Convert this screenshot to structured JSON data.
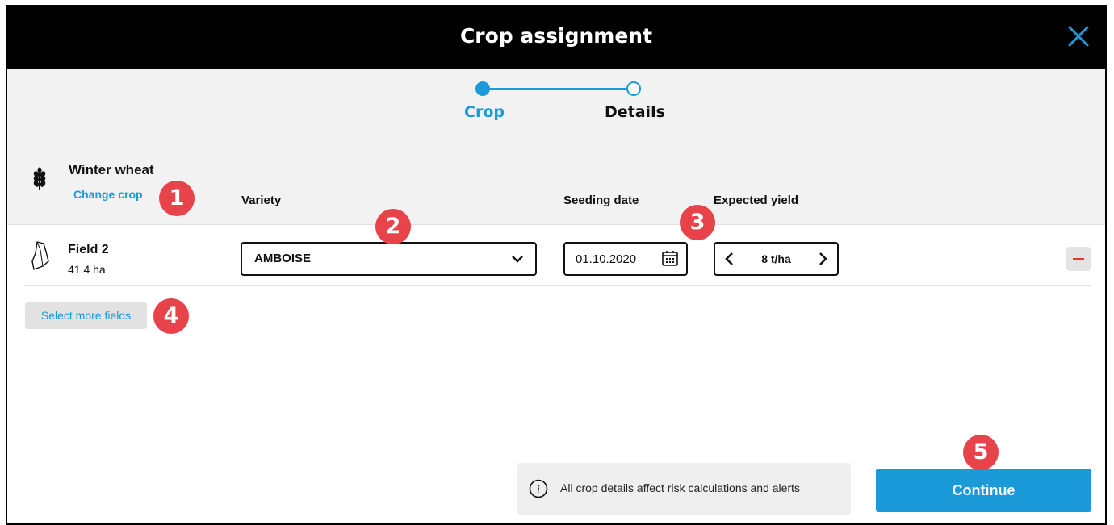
{
  "dialog": {
    "title": "Crop assignment"
  },
  "steps": [
    {
      "label": "Crop"
    },
    {
      "label": "Details"
    }
  ],
  "crop": {
    "name": "Winter wheat",
    "change_label": "Change crop"
  },
  "columns": {
    "variety": "Variety",
    "seeding_date": "Seeding date",
    "expected_yield": "Expected yield"
  },
  "field": {
    "name": "Field 2",
    "area": "41.4 ha",
    "variety": "AMBOISE",
    "seeding_date": "01.10.2020",
    "expected_yield": "8 t/ha"
  },
  "select_more_label": "Select more fields",
  "info_text": "All crop details affect risk calculations and alerts",
  "continue_label": "Continue",
  "annotations": [
    "1",
    "2",
    "3",
    "4",
    "5"
  ],
  "colors": {
    "accent": "#1a9ad9",
    "badge": "#e8424a",
    "remove": "#e03c2a"
  }
}
